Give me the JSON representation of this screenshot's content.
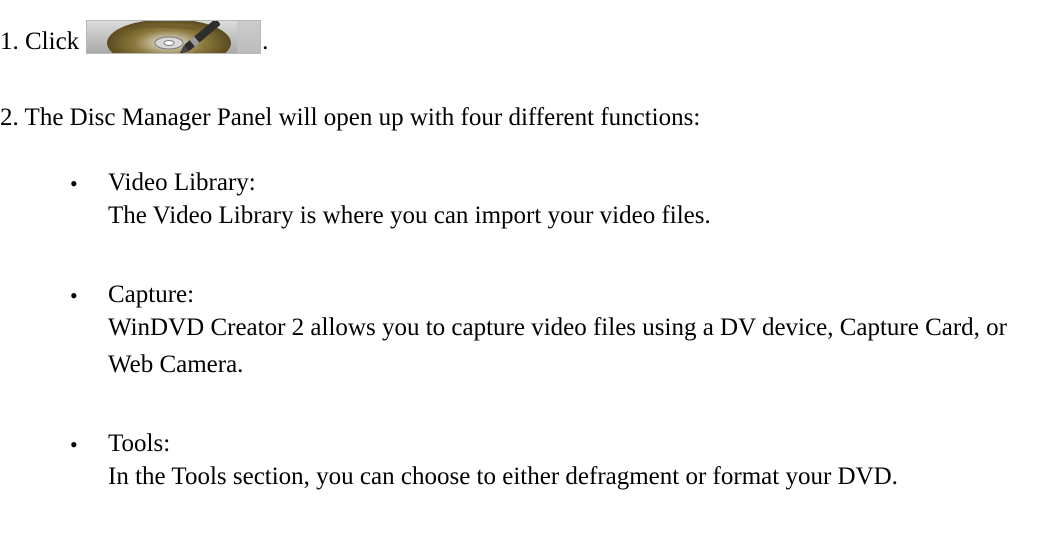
{
  "step1": {
    "prefix": "1. Click",
    "button_icon": "disc-manager-icon",
    "suffix": "."
  },
  "step2": {
    "text": "2. The Disc Manager Panel will open up with four different functions:"
  },
  "functions": [
    {
      "title": "Video Library:",
      "description": "The Video Library is where you can import your video files."
    },
    {
      "title": "Capture:",
      "description": "WinDVD Creator 2 allows you to capture video files using a DV device, Capture Card, or Web Camera."
    },
    {
      "title": "Tools:",
      "description": "In the Tools section, you can choose to either defragment or format your DVD."
    }
  ],
  "bullet_char": "•"
}
